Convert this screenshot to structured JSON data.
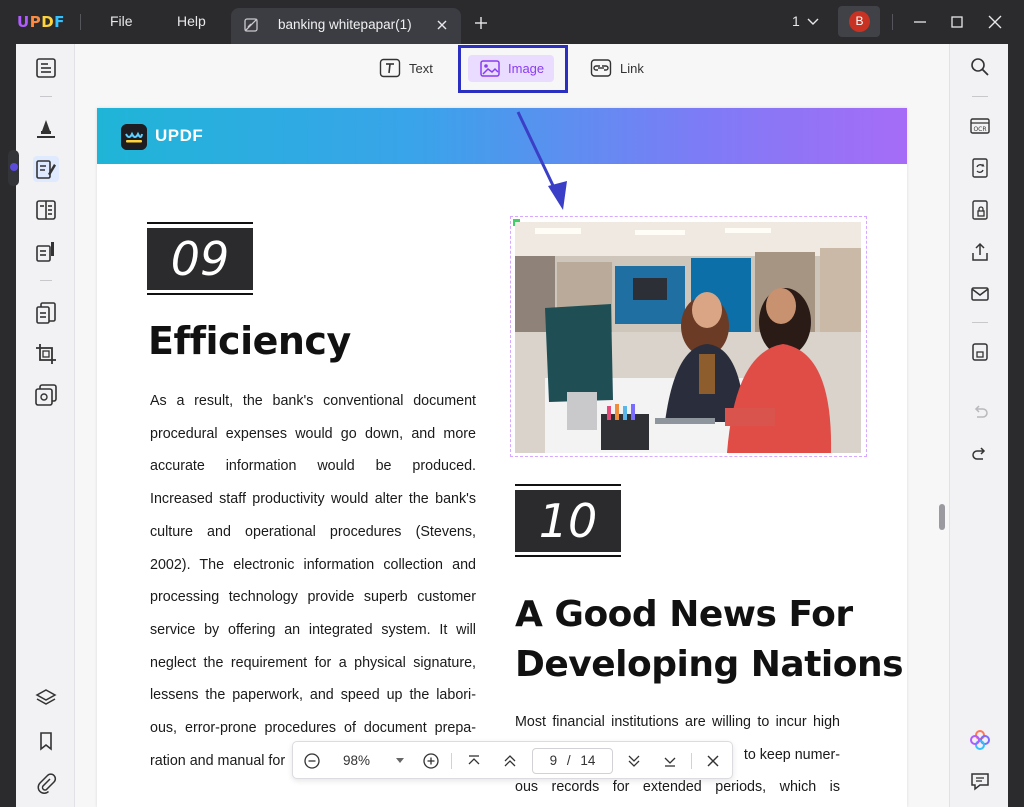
{
  "app": {
    "logo": [
      "U",
      "P",
      "D",
      "F"
    ],
    "menus": [
      "File",
      "Help"
    ],
    "tab_title": "banking whitepapar(1)",
    "page_indicator": "1",
    "avatar_initial": "B"
  },
  "edit_modes": {
    "text": "Text",
    "image": "Image",
    "link": "Link",
    "active": "image"
  },
  "document": {
    "header_brand": "UPDF",
    "section_09": {
      "number": "09",
      "title": "Efficiency",
      "lines": [
        "As a result, the bank's conventional document",
        "procedural expenses would go down, and more",
        "accurate information would be produced.",
        "Increased staff productivity would alter the bank's",
        "culture and operational procedures (Stevens,",
        "2002). The electronic information collection and",
        "processing technology provide superb customer",
        "service by offering an integrated system. It will",
        "neglect the requirement for a physical signature,",
        "lessens the paperwork, and speed up the labori-",
        "ous, error-prone procedures of document prepa-",
        "ration and manual for"
      ]
    },
    "section_10": {
      "number": "10",
      "title_line1": "A Good News For",
      "title_line2": "Developing Nations",
      "lines": [
        "Most financial institutions are willing to incur high",
        "to keep numer-",
        "ous records for extended periods, which is"
      ]
    }
  },
  "page_toolbar": {
    "zoom": "98%",
    "current_page": "9",
    "separator": "/",
    "total_pages": "14"
  },
  "colors": {
    "accent_callout": "#2a2fc2",
    "image_mode_bg": "#e9dcff",
    "image_mode_fg": "#8a3cf2"
  }
}
